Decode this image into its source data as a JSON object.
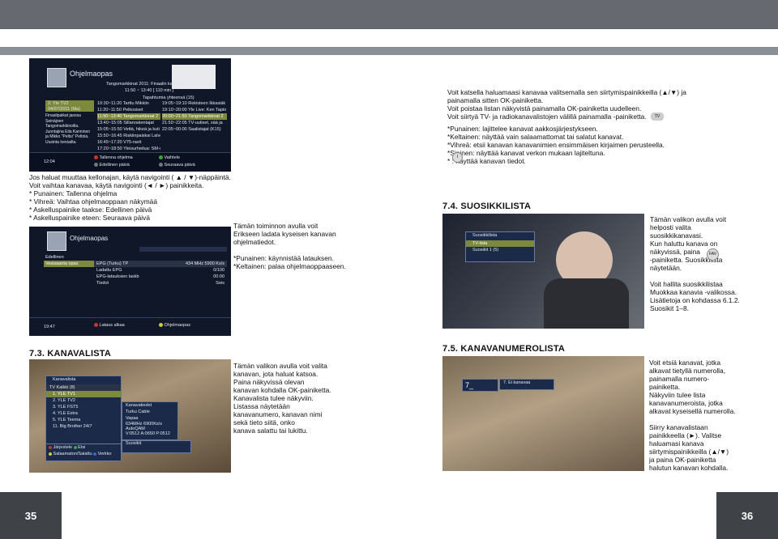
{
  "pages": {
    "left": "35",
    "right": "36"
  },
  "epg_screen": {
    "title": "Ohjelmaopas",
    "now_title": "Tangomarkkinat 2011: Finaalin karsinta",
    "now_time": "11:50 ~ 13:40 [ 110 min ]",
    "date_label": "Tapahtumia yhteensä (15)",
    "channel_selected": "2. Yle TV2",
    "channel_time": "04/07/2011 (Ma)",
    "description": "Finaalipaikat jaossa Seinäjoen Tangomarkkinoilla. Juontajina Eila Kanninen ja Mikko \"Peltsi\" Peltola. Uusinta torstailta.",
    "col1": [
      "10:30~11:20 Tarttu Mikkiin",
      "11:20~11:50 Pelkosiset",
      "11:50~13:40 Tangomarkkinat 2",
      "13:40~15:05 Sillanrakentajat",
      "15:05~15:50 Vettä, hikeä ja kuti",
      "15:50~16:45 Riskiinpaiskai Lalvoj",
      "16:45~17:20 V75-ravit",
      "17:20~18:50 Yleisurheilua: SM-v",
      "18:50~19:00 TV-uutiset",
      "19:00~19:05 Urheiluruutu"
    ],
    "col2": [
      "19:05~19:10 Rekisteen Ikkasiäk",
      "19:10~20:00 Yle Live: Ken Tapio",
      "20:00~21:50 Tangomarkkinat 2",
      "21:50~22:05 TV-uutiset, sää ja",
      "22:05~00:00 Saalistajat (K15)"
    ],
    "clock": "12:04",
    "footer": [
      "Tallenna ohjelma",
      "Edellinen päivä",
      "Vaihtele",
      "Seuraava päivä"
    ]
  },
  "intro_text": "Jos haluat muuttaa kellonajan, käytä navigointi ( ▲ / ▼)-näppäintä.\nVoit vaihtaa kanavaa, käytä navigointi (◄ / ►) painikkeita.\n* Punainen: Tallenna ohjelma\n* Vihreä: Vaihtaa ohjelmaoppaan näkymää\n* Askelluspainike taakse: Edellinen päivä\n* Askelluspainike eteen: Seuraava päivä",
  "download_screen": {
    "title": "Ohjelmaopas",
    "prev": "Edellinen",
    "sub": "Vesisaanta opas",
    "rows": [
      [
        "EPG (Turku) TP",
        "434 MHz 5900 Ks/s"
      ],
      [
        "Ladattu EPG",
        "0/100"
      ],
      [
        "EPG-latauksien laskb",
        "00:00"
      ],
      [
        "Tiedot",
        "Seis"
      ]
    ],
    "clock": "19:47",
    "footer": [
      "Lataus alkaa",
      "Ohjelmaopas"
    ]
  },
  "download_text": "Tämän toiminnon avulla voit\nErikseen ladata kyseisen kanavan\nohjelmatiedot.\n\n*Punainen: käynnistää latauksen.\n*Keltainen: palaa ohjelmaoppaaseen.",
  "right_text_1": "Voit katsella haluamaasi kanavaa valitsemalla sen siirtymispainikkeilla (▲/▼) ja\npainamalla sitten OK-painiketta.\nVoit poistaa listan näkyvistä painamalla OK-painiketta uudelleen.\nVoit siirtyä TV- ja radiokanavalistojen välillä painamalla        -painiketta.",
  "right_text_2": "*Punainen: lajittelee kanavat aakkosjärjestykseen.\n*Keltainen: näyttää vain salaamattomat tai salatut kanavat.\n*Vihreä: etsii kanavan kanavanimien ensimmäisen kirjaimen perusteella.\n*Sininen: näyttää kanavat verkon mukaan lajiteltuna.\n*       : näyttää kanavan tiedot.",
  "fav": {
    "heading": "7.4. SUOSIKKILISTA",
    "screen_title": "Suosikkilista",
    "items": [
      "TV-lista",
      "Suosikit 1 (5)"
    ],
    "text": "Tämän valikon avulla voit\nhelposti valita\nsuosikkikanavasi.\nKun haluttu kanava on\nnäkyvissä, paina\n-painiketta. Suosikkilista\nnäytetään.\n\nVoit hallita suosikkilistaa\nMuokkaa kanavia -valikossa.\nLisätietoja on kohdassa 6.1.2.\nSuosikit 1–8.",
    "fav_icon": "FAV"
  },
  "chlist": {
    "heading": "7.3. KANAVALISTA",
    "screen_title": "Kanavalista",
    "tab": "TV Kaikki (8)",
    "items": [
      "1. YLE TV1",
      "2. YLE TV2",
      "3. YLE FST5",
      "4. YLE Extra",
      "5. YLE Teema",
      "11. Big Brother 24/7"
    ],
    "info_title": "Kanavatiedot",
    "info": [
      "Turku Cable",
      "Vapaa",
      "634MHz 6900Ks/s AutoQAM",
      "V:0512 A:0650 P:0512"
    ],
    "search": "Suosikit",
    "footer": [
      "Järjestele",
      "Etsi",
      "Salaamaton/Salattu",
      "Verkko"
    ],
    "text": "Tämän valikon avulla voit valita\nkanavan, jota haluat katsoa.\nPaina näkyvissä olevan\nkanavan kohdalla OK-painiketta.\nKanavalista tulee näkyviin.\nListassa näytetään\nkanavanumero, kanavan nimi\nsekä tieto siitä, onko\nkanava salattu tai lukittu."
  },
  "chnum": {
    "heading": "7.5. KANAVANUMEROLISTA",
    "input": "7_",
    "item": "7. Ei kanavaa",
    "text": "Voit etsiä kanavat, jotka\nalkavat tietyllä numerolla,\npainamalla numero-\npainiketta.\nNäkyviin tulee lista\nkanavanumeroista, jotka\nalkavat kyseisellä numerolla.\n\nSiirry kanavalistaan\npainikkeella (►). Valitse\nhaluamasi kanava\nsiirtymispainikkeilla (▲/▼)\nja paina OK-painiketta\nhalutun kanavan kohdalla."
  },
  "colors": {
    "bar": "#666a70",
    "stripe": "#8a8f96",
    "page_box": "#3f4347",
    "osd_blue": "#1b2a48",
    "osd_sel": "#7d8a3c"
  }
}
